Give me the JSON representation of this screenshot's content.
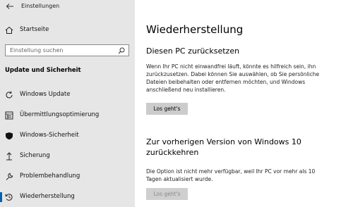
{
  "window": {
    "title": "Einstellungen"
  },
  "sidebar": {
    "home_label": "Startseite",
    "search_placeholder": "Einstellung suchen",
    "section_title": "Update und Sicherheit",
    "items": [
      {
        "label": "Windows Update",
        "icon": "refresh-icon"
      },
      {
        "label": "Übermittlungsoptimierung",
        "icon": "delivery-optimization-icon"
      },
      {
        "label": "Windows-Sicherheit",
        "icon": "shield-icon"
      },
      {
        "label": "Sicherung",
        "icon": "backup-arrow-icon"
      },
      {
        "label": "Problembehandlung",
        "icon": "wrench-icon"
      },
      {
        "label": "Wiederherstellung",
        "icon": "recovery-icon",
        "selected": true
      }
    ]
  },
  "main": {
    "page_title": "Wiederherstellung",
    "reset": {
      "heading": "Diesen PC zurücksetzen",
      "description": "Wenn Ihr PC nicht einwandfrei läuft, könnte es hilfreich sein, ihn zurückzusetzen. Dabei können Sie auswählen, ob Sie persönliche Dateien beibehalten oder entfernen möchten, und Windows anschließend neu installieren.",
      "button": "Los geht's"
    },
    "rollback": {
      "heading": "Zur vorherigen Version von Windows 10 zurückkehren",
      "description": "Die Option ist nicht mehr verfügbar, weil Ihr PC vor mehr als 10 Tagen aktualisiert wurde.",
      "button": "Los geht's"
    }
  },
  "colors": {
    "sidebar_bg": "#e6e6e6",
    "accent": "#0063b1",
    "button_bg": "#cccccc"
  }
}
